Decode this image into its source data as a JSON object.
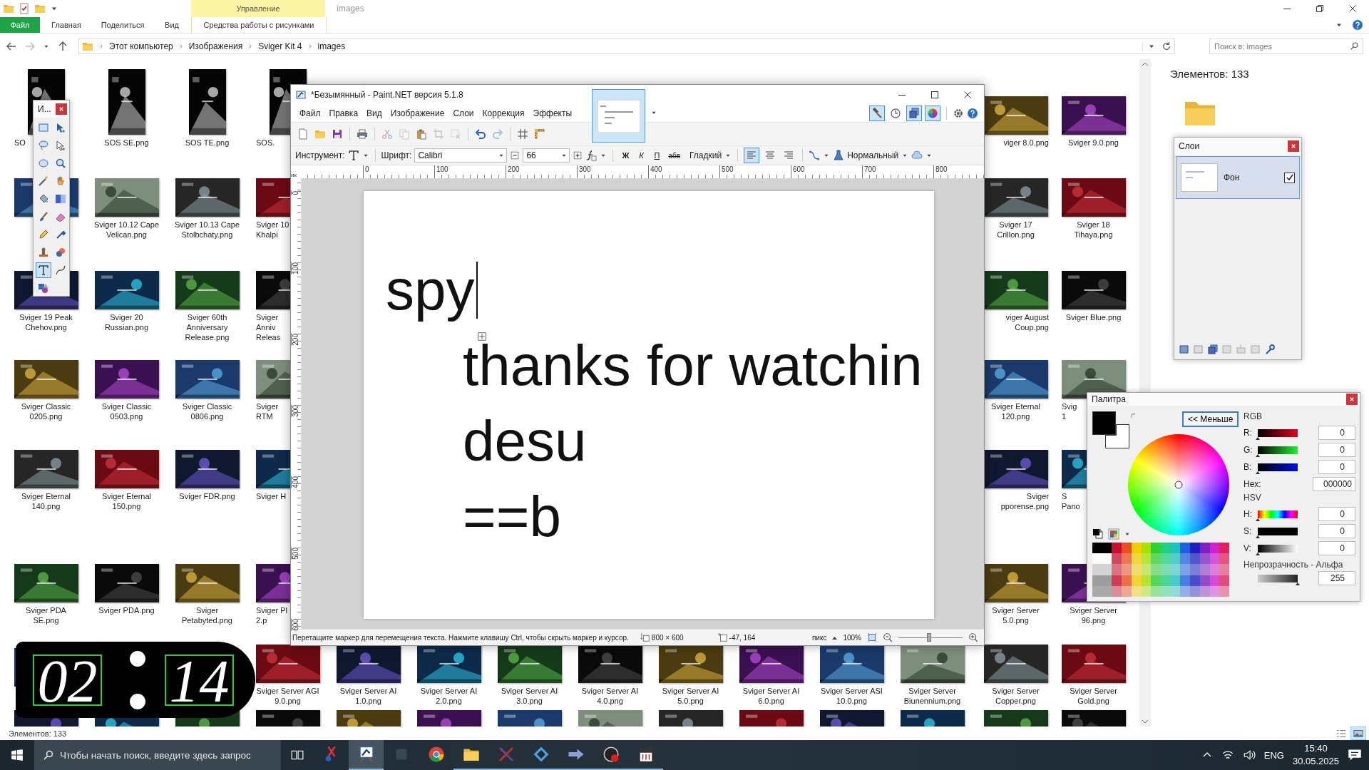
{
  "explorer": {
    "title": "images",
    "context_tab": "Управление",
    "file_menu": "Файл",
    "ribbon_tabs": [
      {
        "label": "Главная",
        "selected": false,
        "kind": "plain"
      },
      {
        "label": "Поделиться",
        "selected": false,
        "kind": "plain"
      },
      {
        "label": "Вид",
        "selected": false,
        "kind": "plain"
      },
      {
        "label": "Средства работы с рисунками",
        "selected": false,
        "kind": "context"
      }
    ],
    "breadcrumb": [
      "Этот компьютер",
      "Изображения",
      "Sviger Kit 4",
      "images"
    ],
    "search": {
      "placeholder": "Поиск в: images"
    },
    "file_rows": [
      [
        {
          "kind": "portrait",
          "name": "SO",
          "clipped": true
        },
        {
          "kind": "portrait",
          "name": "SOS SE.png",
          "clipped": false
        },
        {
          "kind": "portrait",
          "name": "SOS TE.png",
          "clipped": false
        },
        {
          "kind": "portrait",
          "name": "SOS.",
          "clipped": true
        },
        null,
        null,
        null,
        null,
        null,
        null,
        null,
        null,
        {
          "kind": "file",
          "name": "viger 8.0.png",
          "clipped": true
        },
        {
          "kind": "file",
          "name": "Sviger 9.0.png",
          "clipped": false
        }
      ],
      [
        {
          "kind": "thumb"
        },
        {
          "kind": "file",
          "name": "Sviger 10.12 Cape Velican.png",
          "clipped": false
        },
        {
          "kind": "file",
          "name": "Sviger 10.13 Cape Stolbchaty.png",
          "clipped": false
        },
        {
          "kind": "file",
          "name": "Sviger 10\nKhalpi",
          "clipped": true
        },
        null,
        null,
        null,
        null,
        null,
        null,
        null,
        null,
        {
          "kind": "file",
          "name": "Sviger 17 Crillon.png",
          "clipped": false
        },
        {
          "kind": "file",
          "name": "Sviger 18 Tihaya.png",
          "clipped": false
        }
      ],
      [
        {
          "kind": "file",
          "name": "Sviger 19 Peak Chehov.png",
          "clipped": false
        },
        {
          "kind": "file",
          "name": "Sviger 20 Russian.png",
          "clipped": false
        },
        {
          "kind": "file",
          "name": "Sviger 60th Anniversary Release.png",
          "clipped": false
        },
        {
          "kind": "file",
          "name": "Sviger\nAnniv\nReleas",
          "clipped": true
        },
        null,
        null,
        null,
        null,
        null,
        null,
        null,
        null,
        {
          "kind": "file",
          "name": "viger August\nCoup.png",
          "clipped": true
        },
        {
          "kind": "file",
          "name": "Sviger Blue.png",
          "clipped": false
        }
      ],
      [
        {
          "kind": "file",
          "name": "Sviger Classic 0205.png",
          "clipped": false
        },
        {
          "kind": "file",
          "name": "Sviger Classic 0503.png",
          "clipped": false
        },
        {
          "kind": "file",
          "name": "Sviger Classic 0806.png",
          "clipped": false
        },
        {
          "kind": "file",
          "name": "Sviger\nRTM",
          "clipped": true
        },
        null,
        null,
        null,
        null,
        null,
        null,
        null,
        null,
        {
          "kind": "file",
          "name": "Sviger Eternal 120.png",
          "clipped": false
        },
        {
          "kind": "file",
          "name": "Svig\n1",
          "clipped": true
        }
      ],
      [
        {
          "kind": "file",
          "name": "Sviger Eternal 140.png",
          "clipped": false
        },
        {
          "kind": "file",
          "name": "Sviger Eternal 150.png",
          "clipped": false
        },
        {
          "kind": "file",
          "name": "Sviger FDR.png",
          "clipped": false
        },
        {
          "kind": "file",
          "name": "Sviger H",
          "clipped": true
        },
        null,
        null,
        null,
        null,
        null,
        null,
        null,
        null,
        {
          "kind": "file",
          "name": "Sviger\npporense.png",
          "clipped": true
        },
        {
          "kind": "file",
          "name": "S\nPano",
          "clipped": true
        }
      ],
      [
        {
          "kind": "file",
          "name": "Sviger PDA SE.png",
          "clipped": false
        },
        {
          "kind": "file",
          "name": "Sviger PDA.png",
          "clipped": false
        },
        {
          "kind": "file",
          "name": "Sviger Petabyted.png",
          "clipped": false
        },
        {
          "kind": "file",
          "name": "Sviger Pl\n2.p",
          "clipped": true
        },
        null,
        null,
        null,
        null,
        null,
        null,
        null,
        null,
        {
          "kind": "file",
          "name": "Sviger Server 5.0.png",
          "clipped": false
        },
        {
          "kind": "file",
          "name": "Sviger Server 96.png",
          "clipped": false
        }
      ],
      [
        {
          "kind": "thumb"
        },
        null,
        null,
        {
          "kind": "file",
          "name": "Sviger Server AGI 9.0.png",
          "clipped": false
        },
        {
          "kind": "file",
          "name": "Sviger Server AI 1.0.png",
          "clipped": false
        },
        {
          "kind": "file",
          "name": "Sviger Server AI 2.0.png",
          "clipped": false
        },
        {
          "kind": "file",
          "name": "Sviger Server AI 3.0.png",
          "clipped": false
        },
        {
          "kind": "file",
          "name": "Sviger Server AI 4.0.png",
          "clipped": false
        },
        {
          "kind": "file",
          "name": "Sviger Server AI 5.0.png",
          "clipped": false
        },
        {
          "kind": "file",
          "name": "Sviger Server AI 6.0.png",
          "clipped": false
        },
        {
          "kind": "file",
          "name": "Sviger Server ASI 10.0.png",
          "clipped": false
        },
        {
          "kind": "file",
          "name": "Sviger Server Biunennium.png",
          "clipped": false
        },
        {
          "kind": "file",
          "name": "Sviger Server Copper.png",
          "clipped": false
        },
        {
          "kind": "file",
          "name": "Sviger Server Gold.png",
          "clipped": false
        }
      ],
      [
        {
          "kind": "thumb"
        },
        {
          "kind": "thumb"
        },
        {
          "kind": "thumb"
        },
        {
          "kind": "thumb"
        },
        {
          "kind": "thumb"
        },
        {
          "kind": "thumb"
        },
        {
          "kind": "thumb"
        },
        {
          "kind": "thumb"
        },
        {
          "kind": "thumb"
        },
        {
          "kind": "thumb"
        },
        {
          "kind": "thumb"
        },
        {
          "kind": "thumb"
        },
        {
          "kind": "thumb"
        },
        {
          "kind": "thumb"
        }
      ]
    ],
    "details_count": "Элементов: 133",
    "status_bar": "Элементов: 133",
    "view_buttons": [
      {
        "kind": "details",
        "selected": false
      },
      {
        "kind": "thumbnails",
        "selected": true
      }
    ]
  },
  "paint": {
    "title": "*Безымянный - Paint.NET версия 5.1.8",
    "menu": [
      "Файл",
      "Правка",
      "Вид",
      "Изображение",
      "Слои",
      "Коррекция",
      "Эффекты"
    ],
    "toolbar": [
      {
        "kind": "new-page",
        "disabled": false
      },
      {
        "kind": "folder",
        "disabled": false
      },
      {
        "kind": "floppy",
        "disabled": false
      },
      {
        "kind": "printer",
        "disabled": false
      },
      {
        "kind": "scissors",
        "disabled": true
      },
      {
        "kind": "copy",
        "disabled": true
      },
      {
        "kind": "clipboard",
        "disabled": false
      },
      {
        "kind": "crop",
        "disabled": true
      },
      {
        "kind": "deselect",
        "disabled": true
      },
      {
        "kind": "undo",
        "disabled": false
      },
      {
        "kind": "redo",
        "disabled": true
      },
      {
        "kind": "grid",
        "disabled": false
      },
      {
        "kind": "ruler",
        "disabled": false
      }
    ],
    "panel_toggles": [
      {
        "kind": "hammer",
        "selected": true
      },
      {
        "kind": "clock",
        "selected": false
      },
      {
        "kind": "layers",
        "selected": true
      },
      {
        "kind": "color-wheel",
        "selected": true
      }
    ],
    "options": {
      "tool_label": "Инструмент:",
      "font_label": "Шрифт:",
      "font": "Calibri",
      "size": "66",
      "styles": [
        {
          "label": "Ж",
          "kind": "bold",
          "selected": false
        },
        {
          "label": "К",
          "kind": "italic",
          "selected": false
        },
        {
          "label": "П",
          "kind": "underline",
          "selected": false
        },
        {
          "label": "абв",
          "kind": "strike",
          "selected": false
        }
      ],
      "antialias": "Гладкий",
      "alignment": [
        {
          "kind": "align-left",
          "selected": true
        },
        {
          "kind": "align-center",
          "selected": false
        },
        {
          "kind": "align-right",
          "selected": false
        }
      ],
      "blend": "Нормальный"
    },
    "ruler_unit": "ик",
    "ruler_h": [
      "0",
      "100",
      "200",
      "300",
      "400",
      "500",
      "600",
      "700",
      "800"
    ],
    "ruler_v": [
      "0",
      "100",
      "200",
      "300",
      "400",
      "500",
      "600"
    ],
    "canvas_lines": [
      {
        "text": "spy",
        "cursor": true
      },
      {
        "text": "thanks for watchin",
        "cursor": false
      },
      {
        "text": "desu",
        "cursor": false
      },
      {
        "text": "==b",
        "cursor": false
      }
    ],
    "status": {
      "hint": "Перетащите маркер для перемещения текста. Нажмите клавишу Ctrl, чтобы скрыть маркер и курсор.",
      "size": "800 × 600",
      "position": "-47, 164",
      "unit": "пикс",
      "zoom": "100%",
      "zoom_slider": {
        "level": 0.48
      }
    }
  },
  "tools_window": {
    "title": "И...",
    "tools": [
      {
        "kind": "rect-select",
        "selected": false
      },
      {
        "kind": "move-cursor",
        "selected": false
      },
      {
        "kind": "lasso",
        "selected": false
      },
      {
        "kind": "move-outline",
        "selected": false
      },
      {
        "kind": "ellipse",
        "selected": false
      },
      {
        "kind": "magnifier",
        "selected": false
      },
      {
        "kind": "wand",
        "selected": false
      },
      {
        "kind": "hand",
        "selected": false
      },
      {
        "kind": "bucket",
        "selected": false
      },
      {
        "kind": "gradient",
        "selected": false
      },
      {
        "kind": "brush",
        "selected": false
      },
      {
        "kind": "eraser",
        "selected": false
      },
      {
        "kind": "pencil",
        "selected": false
      },
      {
        "kind": "pipette",
        "selected": false
      },
      {
        "kind": "stamp",
        "selected": false
      },
      {
        "kind": "recolor",
        "selected": false
      },
      {
        "kind": "text-t",
        "selected": true
      },
      {
        "kind": "line-curve",
        "selected": false
      },
      {
        "kind": "shapes",
        "selected": false
      }
    ]
  },
  "layers_window": {
    "title": "Слои",
    "layers": [
      {
        "name": "Фон",
        "selected": true,
        "visible": true
      }
    ]
  },
  "palette_window": {
    "title": "Палитра",
    "toggle": "<< Меньше",
    "swatches": [
      {
        "kind": "primary",
        "color": "#000000"
      },
      {
        "kind": "secondary",
        "color": "#ffffff"
      }
    ],
    "rgb_label": "RGB",
    "rgb": [
      {
        "label": "R:",
        "kind": "red",
        "value": "0",
        "level": 0
      },
      {
        "label": "G:",
        "kind": "green",
        "value": "0",
        "level": 0
      },
      {
        "label": "B:",
        "kind": "blue",
        "value": "0",
        "level": 0
      }
    ],
    "hex_label": "Hex:",
    "hex": "000000",
    "hsv_label": "HSV",
    "hsv": [
      {
        "label": "H:",
        "kind": "hue",
        "value": "0",
        "level": 0
      },
      {
        "label": "S:",
        "kind": "saturation",
        "value": "0",
        "level": 0
      },
      {
        "label": "V:",
        "kind": "brightness",
        "value": "0",
        "level": 0
      }
    ],
    "alpha_label": "Непрозрачность - Альфа",
    "alpha": {
      "value": "255",
      "level": 1
    }
  },
  "clock": {
    "hours": "02",
    "minutes": "14"
  },
  "taskbar": {
    "search": {
      "placeholder": "Чтобы начать поиск, введите здесь запрос"
    },
    "apps": [
      {
        "kind": "scissors",
        "running": false,
        "active": false
      },
      {
        "kind": "easel",
        "running": true,
        "active": true
      },
      {
        "kind": "dim",
        "running": false,
        "active": false
      },
      {
        "kind": "browser",
        "running": false,
        "active": false
      },
      {
        "kind": "folder",
        "running": true,
        "active": false
      },
      {
        "kind": "swords",
        "running": true,
        "active": false
      },
      {
        "kind": "diamond",
        "running": true,
        "active": false
      },
      {
        "kind": "arrow",
        "running": true,
        "active": false
      },
      {
        "kind": "record",
        "running": true,
        "active": false
      },
      {
        "kind": "clapperboard",
        "running": true,
        "active": false
      }
    ],
    "tray": {
      "language": "ENG",
      "time": "15:40",
      "date": "30.05.2025"
    }
  }
}
